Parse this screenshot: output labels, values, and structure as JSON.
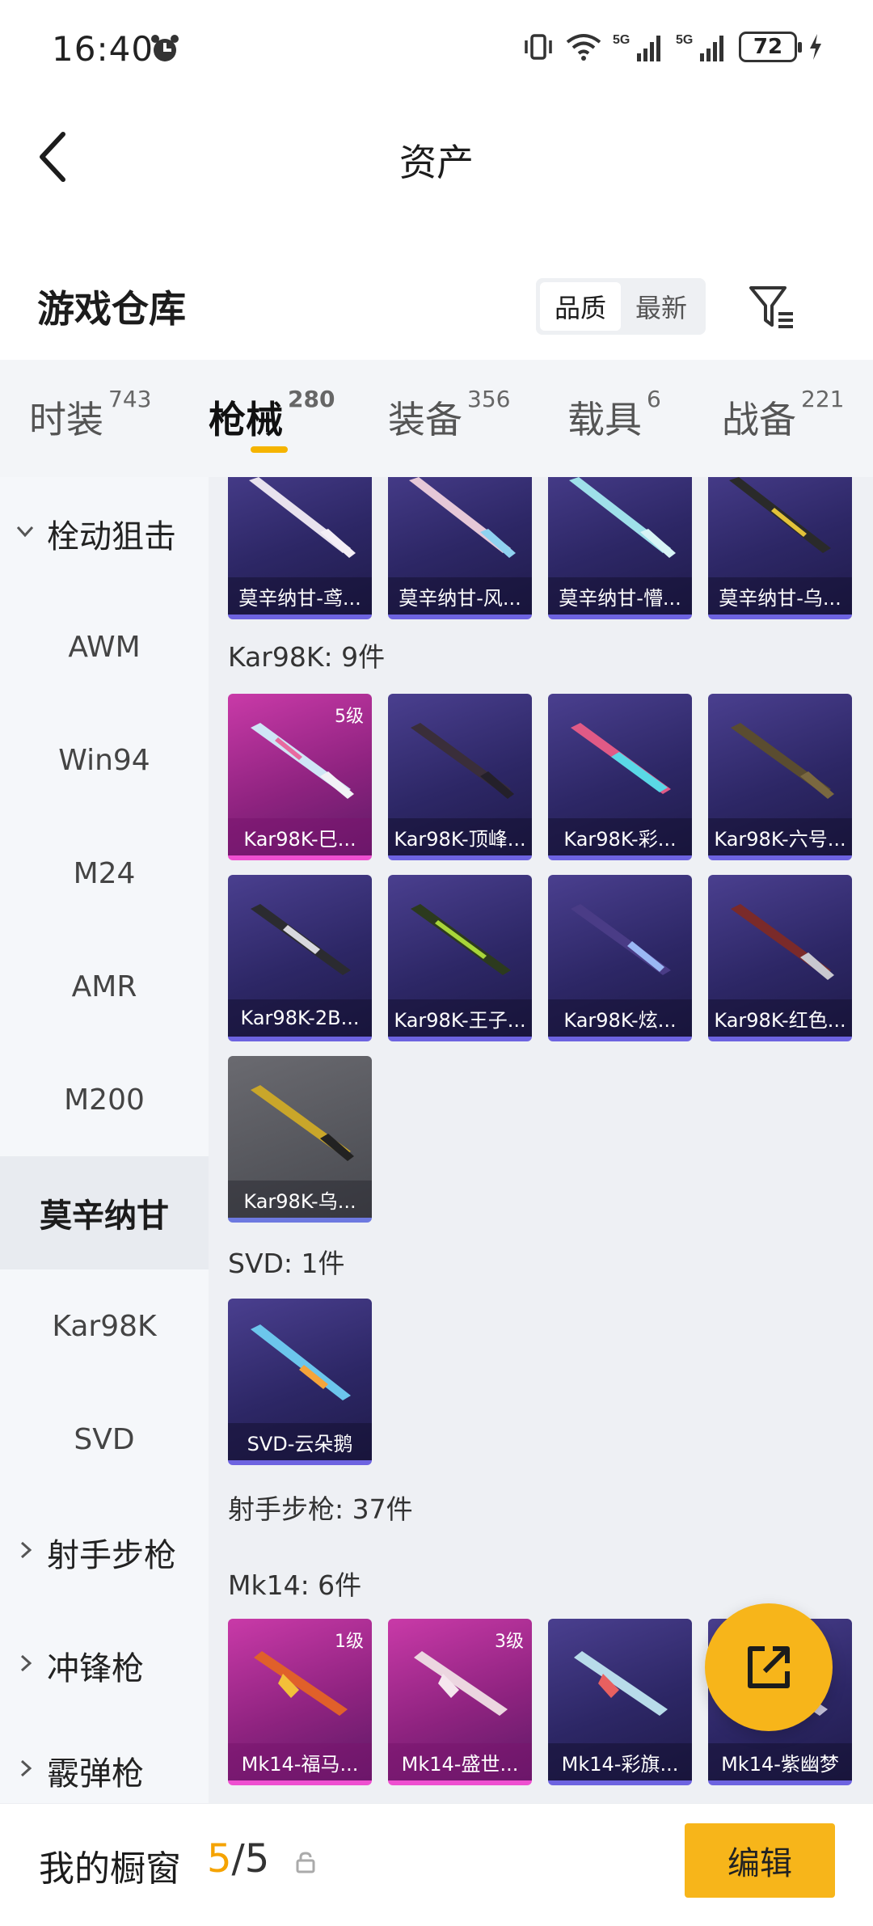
{
  "status_bar": {
    "time": "16:40",
    "battery": "72",
    "icons": [
      "alarm-icon",
      "vibrate-icon",
      "wifi-icon",
      "signal-5g-icon",
      "signal-5g-icon",
      "charging-icon"
    ]
  },
  "header": {
    "title": "资产"
  },
  "warehouse": {
    "title": "游戏仓库",
    "sort_options": [
      "品质",
      "最新"
    ],
    "sort_selected": "品质"
  },
  "tabs": [
    {
      "label": "时装",
      "count": "743"
    },
    {
      "label": "枪械",
      "count": "280",
      "active": true
    },
    {
      "label": "装备",
      "count": "356"
    },
    {
      "label": "载具",
      "count": "6"
    },
    {
      "label": "战备",
      "count": "221"
    }
  ],
  "sidebar": {
    "items": [
      {
        "label": "栓动狙击",
        "type": "group",
        "expanded": true
      },
      {
        "label": "AWM"
      },
      {
        "label": "Win94"
      },
      {
        "label": "M24"
      },
      {
        "label": "AMR"
      },
      {
        "label": "M200"
      },
      {
        "label": "莫辛纳甘",
        "selected": true
      },
      {
        "label": "Kar98K"
      },
      {
        "label": "SVD"
      },
      {
        "label": "射手步枪",
        "type": "group",
        "expanded": false
      },
      {
        "label": "冲锋枪",
        "type": "group",
        "expanded": false
      },
      {
        "label": "霰弹枪",
        "type": "group",
        "expanded": false
      }
    ]
  },
  "content": {
    "top_row": [
      {
        "caption": "莫辛纳甘-鸢...",
        "rarity": "purple"
      },
      {
        "caption": "莫辛纳甘-风...",
        "rarity": "purple"
      },
      {
        "caption": "莫辛纳甘-懵...",
        "rarity": "purple"
      },
      {
        "caption": "莫辛纳甘-乌...",
        "rarity": "purple"
      }
    ],
    "kar_label": "Kar98K: 9件",
    "kar": [
      {
        "caption": "Kar98K-巳...",
        "rarity": "pink",
        "level": "5级"
      },
      {
        "caption": "Kar98K-顶峰...",
        "rarity": "purple"
      },
      {
        "caption": "Kar98K-彩...",
        "rarity": "purple"
      },
      {
        "caption": "Kar98K-六号...",
        "rarity": "purple"
      },
      {
        "caption": "Kar98K-2B...",
        "rarity": "purple"
      },
      {
        "caption": "Kar98K-王子...",
        "rarity": "purple"
      },
      {
        "caption": "Kar98K-炫...",
        "rarity": "purple"
      },
      {
        "caption": "Kar98K-红色...",
        "rarity": "purple"
      },
      {
        "caption": "Kar98K-乌...",
        "rarity": "gray"
      }
    ],
    "svd_label": "SVD: 1件",
    "svd": [
      {
        "caption": "SVD-云朵鹅",
        "rarity": "purple"
      }
    ],
    "marksman_label": "射手步枪: 37件",
    "mk14_label": "Mk14: 6件",
    "mk14": [
      {
        "caption": "Mk14-福马...",
        "rarity": "pink",
        "level": "1级"
      },
      {
        "caption": "Mk14-盛世...",
        "rarity": "pink",
        "level": "3级"
      },
      {
        "caption": "Mk14-彩旗...",
        "rarity": "purple"
      },
      {
        "caption": "Mk14-紫幽梦",
        "rarity": "purple"
      }
    ]
  },
  "bottom": {
    "label": "我的橱窗",
    "current": "5",
    "total": "/5",
    "edit": "编辑"
  },
  "colors": {
    "accent": "#f7b51a",
    "purple_card": "#2d2766",
    "pink_card": "#8f2380",
    "gray_card": "#55565c"
  }
}
